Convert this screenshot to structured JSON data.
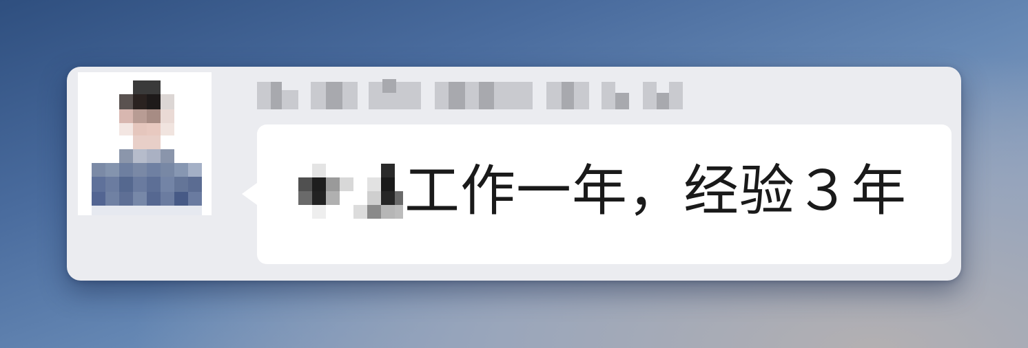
{
  "notification": {
    "message_text": "工作一年，经验３年"
  },
  "colors": {
    "card_background": "#ebecf0",
    "bubble_background": "#ffffff",
    "text": "#1a1a1a"
  },
  "icons": {
    "avatar": "pixelated-avatar",
    "sender_name": "pixelated-redaction"
  }
}
